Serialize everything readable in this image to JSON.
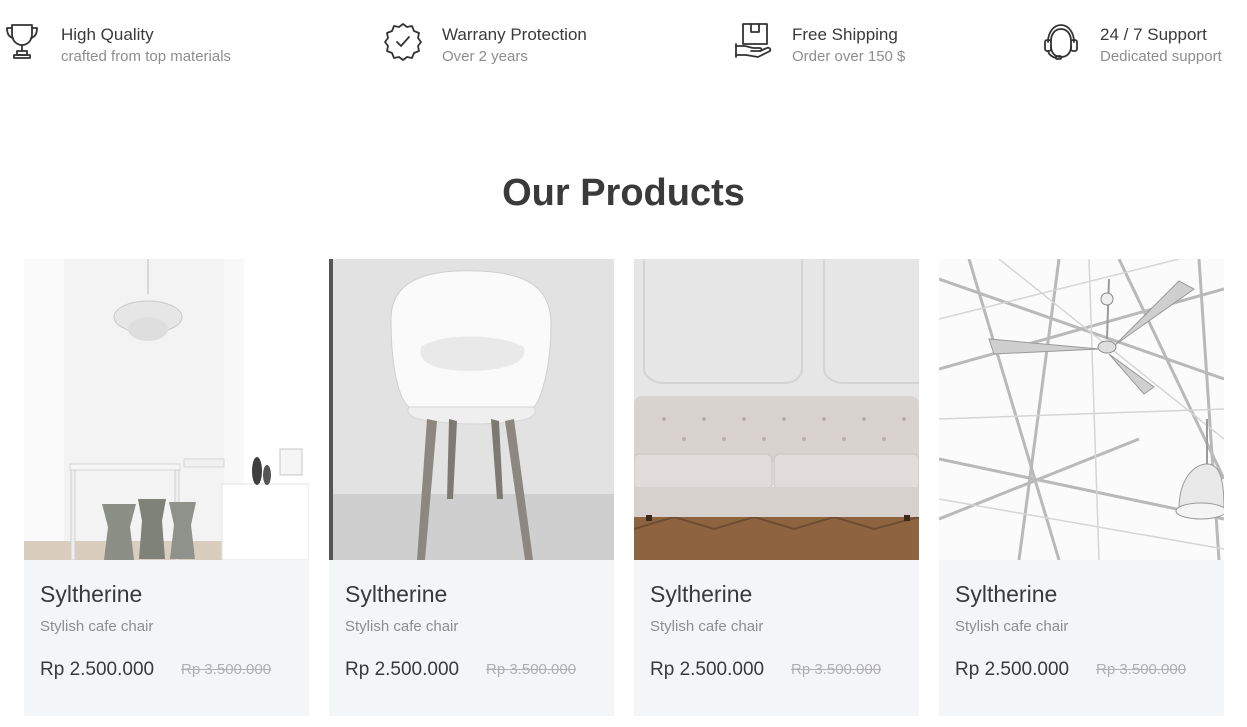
{
  "features": [
    {
      "icon": "trophy-icon",
      "title": "High Quality",
      "subtitle": "crafted from top materials"
    },
    {
      "icon": "badge-check-icon",
      "title": "Warrany Protection",
      "subtitle": "Over 2 years"
    },
    {
      "icon": "shipping-box-icon",
      "title": "Free Shipping",
      "subtitle": "Order over 150 $"
    },
    {
      "icon": "headset-support-icon",
      "title": "24 / 7 Support",
      "subtitle": "Dedicated support"
    }
  ],
  "products_section": {
    "title": "Our Products",
    "items": [
      {
        "image": "dining-room-chandelier-photo",
        "name": "Syltherine",
        "description": "Stylish cafe chair",
        "price": "Rp 2.500.000",
        "old_price": "Rp 3.500.000"
      },
      {
        "image": "white-chair-photo",
        "name": "Syltherine",
        "description": "Stylish cafe chair",
        "price": "Rp 2.500.000",
        "old_price": "Rp 3.500.000"
      },
      {
        "image": "tufted-sofa-photo",
        "name": "Syltherine",
        "description": "Stylish cafe chair",
        "price": "Rp 2.500.000",
        "old_price": "Rp 3.500.000"
      },
      {
        "image": "ceiling-fan-lamp-photo",
        "name": "Syltherine",
        "description": "Stylish cafe chair",
        "price": "Rp 2.500.000",
        "old_price": "Rp 3.500.000"
      }
    ]
  },
  "colors": {
    "text": "#3a3a3a",
    "muted": "#8d8d8d",
    "card_background": "#f4f5f7",
    "strike": "#b0b0b0"
  }
}
